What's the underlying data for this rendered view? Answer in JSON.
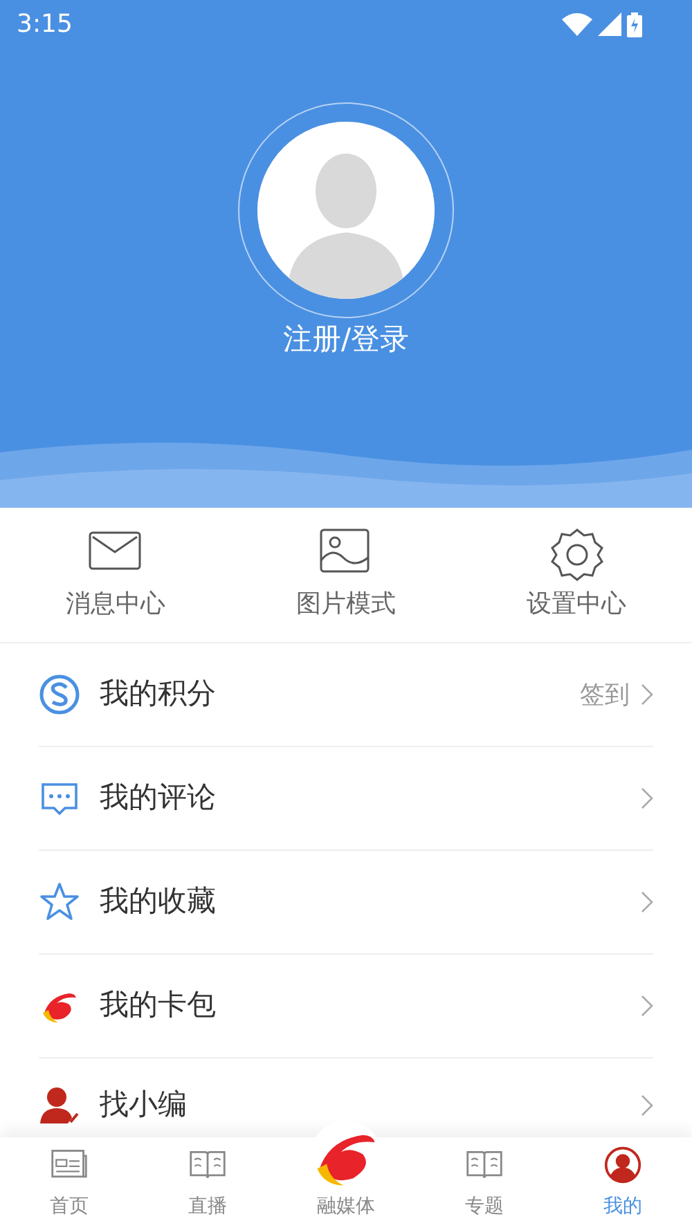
{
  "status_bar": {
    "time": "3:15"
  },
  "profile": {
    "login": "注册/登录"
  },
  "quick_actions": [
    {
      "kind": "mail",
      "label": "消息中心"
    },
    {
      "kind": "picture",
      "label": "图片模式"
    },
    {
      "kind": "gear",
      "label": "设置中心"
    }
  ],
  "menu": [
    {
      "kind": "points",
      "label": "我的积分",
      "action": "签到"
    },
    {
      "kind": "comment",
      "label": "我的评论"
    },
    {
      "kind": "star",
      "label": "我的收藏"
    },
    {
      "kind": "logo",
      "label": "我的卡包"
    },
    {
      "kind": "editor",
      "label": "找小编"
    }
  ],
  "tabs": [
    {
      "kind": "news",
      "label": "首页",
      "selected": false
    },
    {
      "kind": "book",
      "label": "直播",
      "selected": false
    },
    {
      "kind": "logo",
      "label": "融媒体",
      "selected": false
    },
    {
      "kind": "book",
      "label": "专题",
      "selected": false
    },
    {
      "kind": "user",
      "label": "我的",
      "selected": true
    }
  ]
}
